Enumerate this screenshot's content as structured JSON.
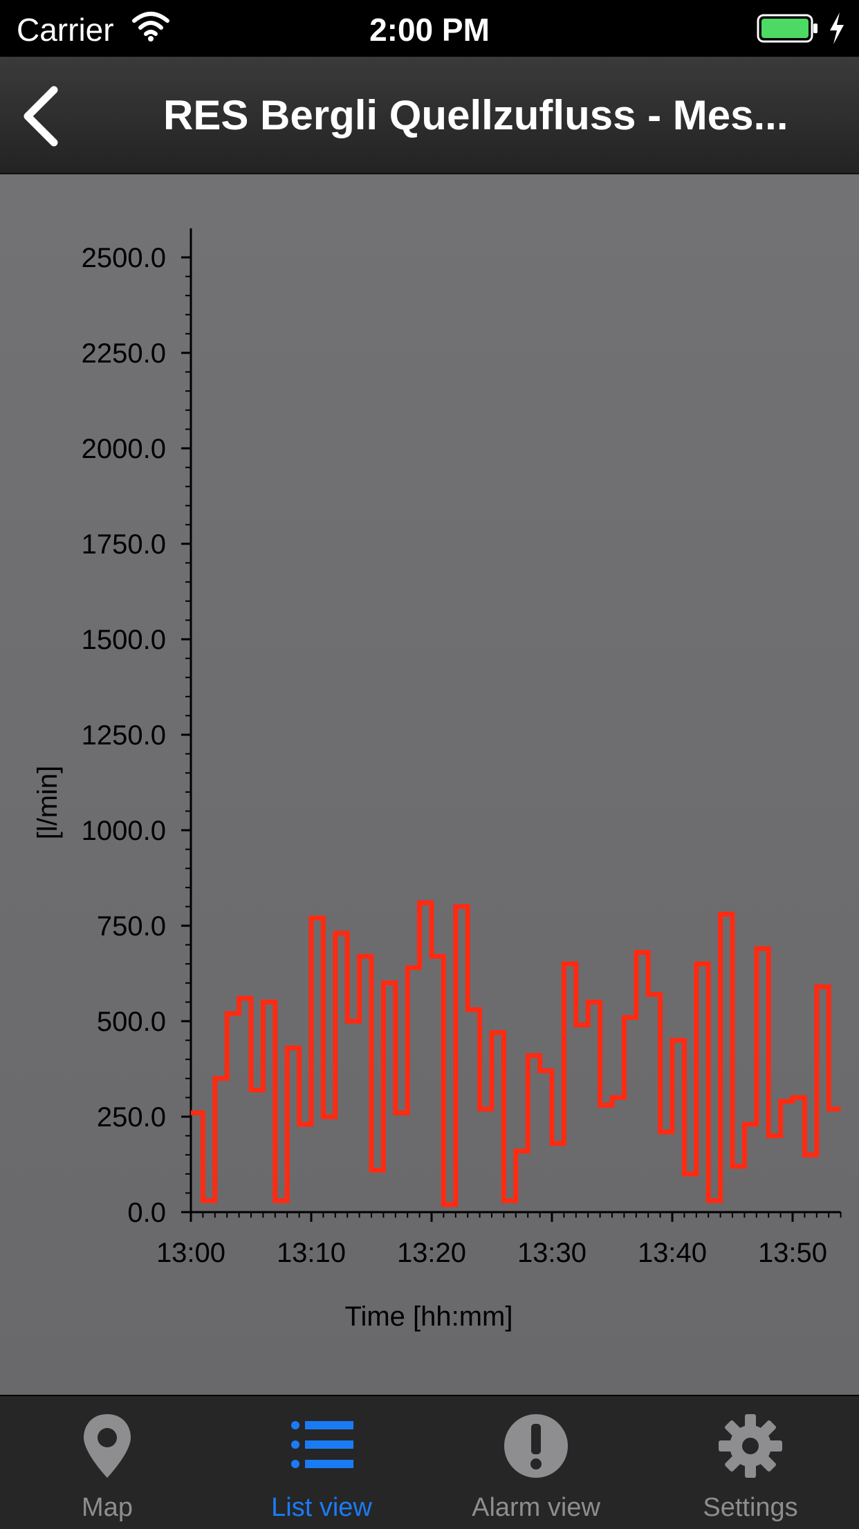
{
  "status_bar": {
    "carrier": "Carrier",
    "time": "2:00 PM"
  },
  "nav": {
    "title": "RES Bergli Quellzufluss - Mes..."
  },
  "tabs": [
    {
      "label": "Map",
      "icon": "map-pin-icon"
    },
    {
      "label": "List view",
      "icon": "list-icon",
      "active": true
    },
    {
      "label": "Alarm view",
      "icon": "alarm-exclamation-icon"
    },
    {
      "label": "Settings",
      "icon": "gear-icon"
    }
  ],
  "colors": {
    "series": "#ff2a12",
    "active_tab": "#1a7cf5",
    "inactive_tab": "#8e8e90"
  },
  "chart_data": {
    "type": "line",
    "step": true,
    "xlabel": "Time [hh:mm]",
    "ylabel": "[l/min]",
    "xlim": [
      "13:00",
      "13:54"
    ],
    "ylim": [
      0,
      2500
    ],
    "yticks": [
      0,
      250,
      500,
      750,
      1000,
      1250,
      1500,
      1750,
      2000,
      2250,
      2500
    ],
    "ytick_labels": [
      "0.0",
      "250.0",
      "500.0",
      "750.0",
      "1000.0",
      "1250.0",
      "1500.0",
      "1750.0",
      "2000.0",
      "2250.0",
      "2500.0"
    ],
    "xtick_labels": [
      "13:00",
      "13:10",
      "13:20",
      "13:30",
      "13:40",
      "13:50"
    ],
    "grid": false,
    "series": [
      {
        "x": [
          "13:00",
          "13:01",
          "13:02",
          "13:03",
          "13:04",
          "13:05",
          "13:06",
          "13:07",
          "13:08",
          "13:09",
          "13:10",
          "13:11",
          "13:12",
          "13:13",
          "13:14",
          "13:15",
          "13:16",
          "13:17",
          "13:18",
          "13:19",
          "13:20",
          "13:21",
          "13:22",
          "13:23",
          "13:24",
          "13:25",
          "13:26",
          "13:27",
          "13:28",
          "13:29",
          "13:30",
          "13:31",
          "13:32",
          "13:33",
          "13:34",
          "13:35",
          "13:36",
          "13:37",
          "13:38",
          "13:39",
          "13:40",
          "13:41",
          "13:42",
          "13:43",
          "13:44",
          "13:45",
          "13:46",
          "13:47",
          "13:48",
          "13:49",
          "13:50",
          "13:51",
          "13:52",
          "13:53"
        ],
        "y": [
          260,
          30,
          350,
          520,
          560,
          320,
          550,
          30,
          430,
          230,
          770,
          250,
          730,
          500,
          670,
          110,
          600,
          260,
          640,
          810,
          670,
          20,
          800,
          530,
          270,
          470,
          30,
          160,
          410,
          370,
          180,
          650,
          490,
          550,
          280,
          300,
          510,
          680,
          570,
          210,
          450,
          100,
          650,
          30,
          780,
          120,
          230,
          690,
          200,
          290,
          300,
          150,
          590,
          270
        ]
      }
    ]
  }
}
